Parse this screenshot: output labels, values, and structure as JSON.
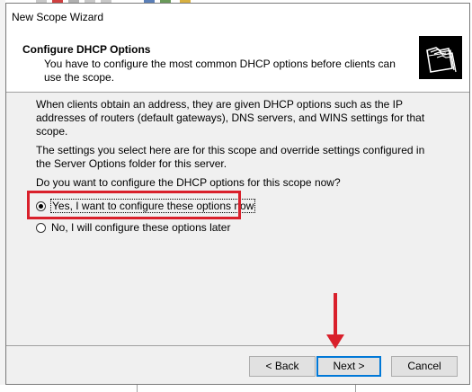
{
  "window": {
    "title": "New Scope Wizard"
  },
  "header": {
    "title": "Configure DHCP Options",
    "subtitle": "You have to configure the most common DHCP options before clients can use the scope.",
    "icon": "folders-icon"
  },
  "body": {
    "paragraph1": "When clients obtain an address, they are given DHCP options such as the IP addresses of routers (default gateways), DNS servers, and WINS settings for that scope.",
    "paragraph2": "The settings you select here are for this scope and override settings configured in the Server Options folder for this server.",
    "question": "Do you want to configure the DHCP options for this scope now?"
  },
  "options": [
    {
      "label": "Yes, I want to configure these options now",
      "selected": true
    },
    {
      "label": "No, I will configure these options later",
      "selected": false
    }
  ],
  "buttons": {
    "back": "< Back",
    "next": "Next >",
    "cancel": "Cancel"
  },
  "annotations": {
    "highlight_color": "#d9202b",
    "focus_color": "#0078d7"
  }
}
